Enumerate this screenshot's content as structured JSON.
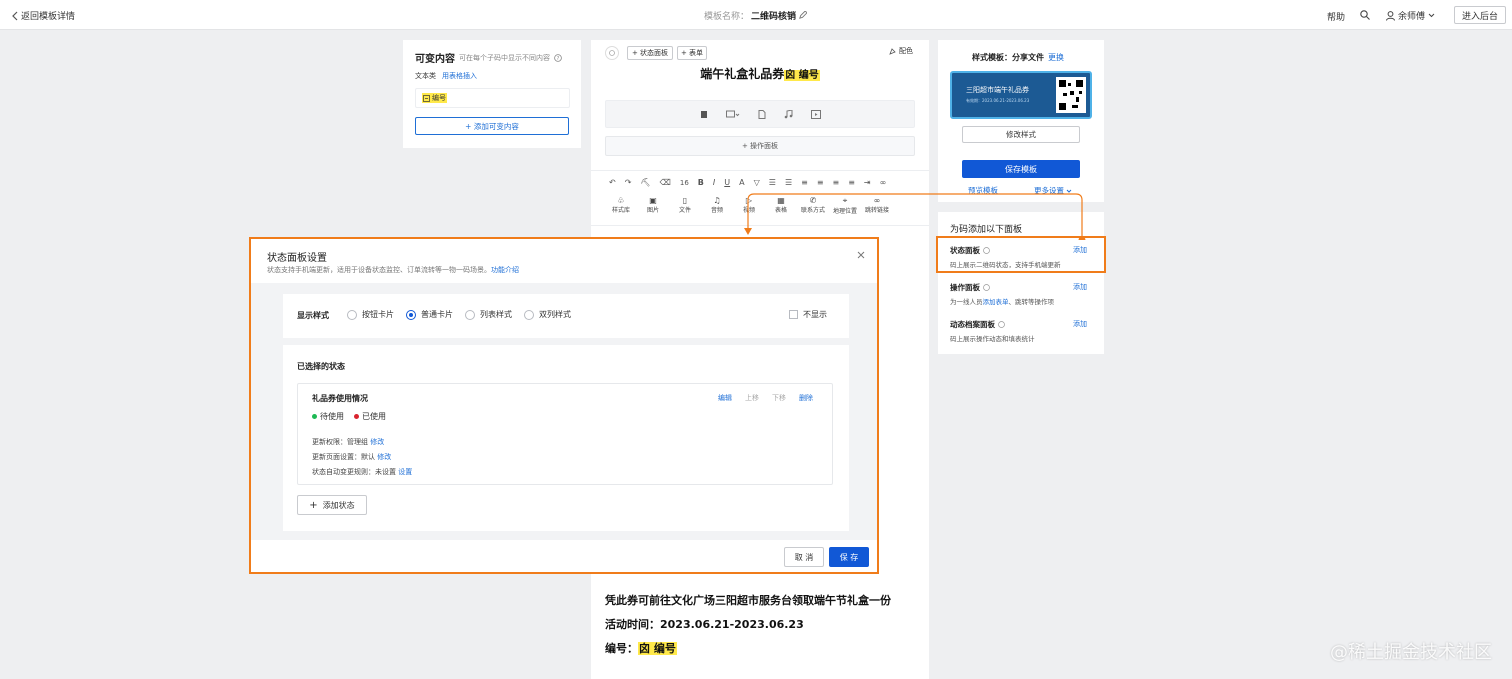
{
  "topbar": {
    "back_label": "返回模板详情",
    "template_name_label": "模板名称：",
    "template_name": "二维码核销",
    "help": "帮助",
    "user": "余师傅",
    "enter_backend": "进入后台"
  },
  "variables": {
    "title": "可变内容",
    "hint": "可在每个子码中显示不同内容",
    "type_label": "文本类",
    "insert_link": "用表格插入",
    "item": "编号",
    "add_button": "+ 添加可变内容"
  },
  "editor": {
    "chip_status": "+ 状态面板",
    "chip_form": "+ 表单",
    "color_label": "配色",
    "heading_main": "端午礼盒礼品券",
    "heading_tag": "编号",
    "op_panel": "+ 操作面板",
    "font_size": "16",
    "insert_tools": [
      "样式库",
      "图片",
      "文件",
      "音频",
      "视频",
      "表格",
      "联系方式",
      "地理位置",
      "跳转链接"
    ],
    "line1": "凭此券可前往文化广场三阳超市服务台领取端午节礼盒一份",
    "line2": "活动时间：2023.06.21-2023.06.23",
    "line3_label": "编号：",
    "line3_tag": "编号"
  },
  "style_panel": {
    "title_prefix": "样式模板：",
    "title_name": "分享文件",
    "change": "更换",
    "preview_title": "三阳超市端午礼品券",
    "preview_date": "有效期：2023.06.21-2023.06.23",
    "modify_button": "修改样式",
    "save_button": "保存模板",
    "preview_link": "预览模板",
    "more_link": "更多设置"
  },
  "add_panels": {
    "title": "为码添加以下面板",
    "items": [
      {
        "name": "状态面板",
        "desc": "码上展示二维码状态，支持手机端更新",
        "action": "添加"
      },
      {
        "name": "操作面板",
        "desc_pre": "为一线人员",
        "desc_link": "添加表单",
        "desc_post": "、跳转等操作项",
        "action": "添加"
      },
      {
        "name": "动态档案面板",
        "desc": "码上展示操作动态和填表统计",
        "action": "添加"
      }
    ]
  },
  "dialog": {
    "title": "状态面板设置",
    "subtitle": "状态支持手机端更新，适用于设备状态监控、订单流转等一物一码场景。",
    "intro_link": "功能介绍",
    "display_style_label": "显示样式",
    "style_options": [
      "按钮卡片",
      "普通卡片",
      "列表样式",
      "双列样式"
    ],
    "selected_style": "普通卡片",
    "hide_label": "不显示",
    "selected_status_title": "已选择的状态",
    "status_card": {
      "name": "礼品券使用情况",
      "actions": [
        "编辑",
        "上移",
        "下移",
        "删除"
      ],
      "states": [
        {
          "label": "待使用",
          "color": "#1db954"
        },
        {
          "label": "已使用",
          "color": "#d9232e"
        }
      ],
      "perm_label": "更新权限：管理组",
      "perm_link": "修改",
      "page_label": "更新页面设置：默认",
      "page_link": "修改",
      "rule_label": "状态自动变更规则：未设置",
      "rule_link": "设置"
    },
    "add_status": "添加状态",
    "cancel": "取 消",
    "save": "保 存"
  },
  "watermark": "@稀土掘金技术社区",
  "colors": {
    "accent": "#1158d6",
    "highlight": "#f07c1a",
    "tag": "#ffe94a"
  }
}
